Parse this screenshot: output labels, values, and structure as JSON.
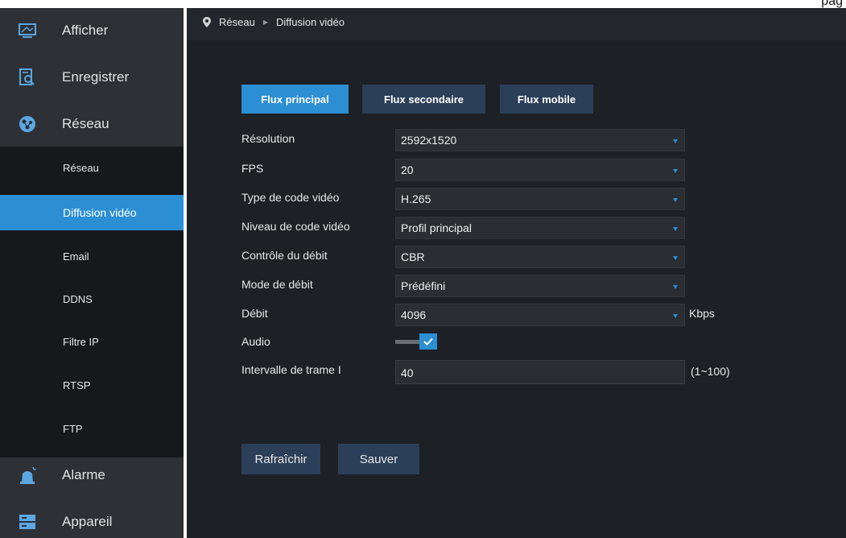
{
  "page_edge_text": "pag",
  "sidebar": {
    "main_items": [
      {
        "label": "Afficher",
        "icon": "monitor-icon"
      },
      {
        "label": "Enregistrer",
        "icon": "record-search-icon"
      },
      {
        "label": "Réseau",
        "icon": "globe-network-icon"
      },
      {
        "label": "Alarme",
        "icon": "alarm-bell-icon"
      },
      {
        "label": "Appareil",
        "icon": "device-storage-icon"
      }
    ],
    "sub_items": [
      {
        "label": "Réseau"
      },
      {
        "label": "Diffusion vidéo",
        "active": true
      },
      {
        "label": "Email"
      },
      {
        "label": "DDNS"
      },
      {
        "label": "Filtre IP"
      },
      {
        "label": "RTSP"
      },
      {
        "label": "FTP"
      }
    ]
  },
  "breadcrumb": {
    "icon": "location-pin-icon",
    "items": [
      "Réseau",
      "Diffusion vidéo"
    ]
  },
  "tabs": [
    {
      "label": "Flux principal",
      "active": true
    },
    {
      "label": "Flux secondaire",
      "active": false
    },
    {
      "label": "Flux mobile",
      "active": false
    }
  ],
  "form": {
    "resolution": {
      "label": "Résolution",
      "value": "2592x1520"
    },
    "fps": {
      "label": "FPS",
      "value": "20"
    },
    "codec_type": {
      "label": "Type de code vidéo",
      "value": "H.265"
    },
    "codec_level": {
      "label": "Niveau de code vidéo",
      "value": "Profil principal"
    },
    "bitrate_control": {
      "label": "Contrôle du débit",
      "value": "CBR"
    },
    "bitrate_mode": {
      "label": "Mode de débit",
      "value": "Prédéfini"
    },
    "bitrate": {
      "label": "Débit",
      "value": "4096",
      "unit": "Kbps"
    },
    "audio": {
      "label": "Audio",
      "enabled": true
    },
    "iframe_interval": {
      "label": "Intervalle de trame I",
      "value": "40",
      "range": "(1~100)"
    }
  },
  "buttons": {
    "refresh_label": "Rafraîchir",
    "save_label": "Sauver"
  },
  "colors": {
    "accent": "#2c8fd4",
    "sidebar_bg": "#2d3035",
    "submenu_bg": "#16181c",
    "content_bg": "#1d2024",
    "button_bg": "#2b3f58"
  }
}
